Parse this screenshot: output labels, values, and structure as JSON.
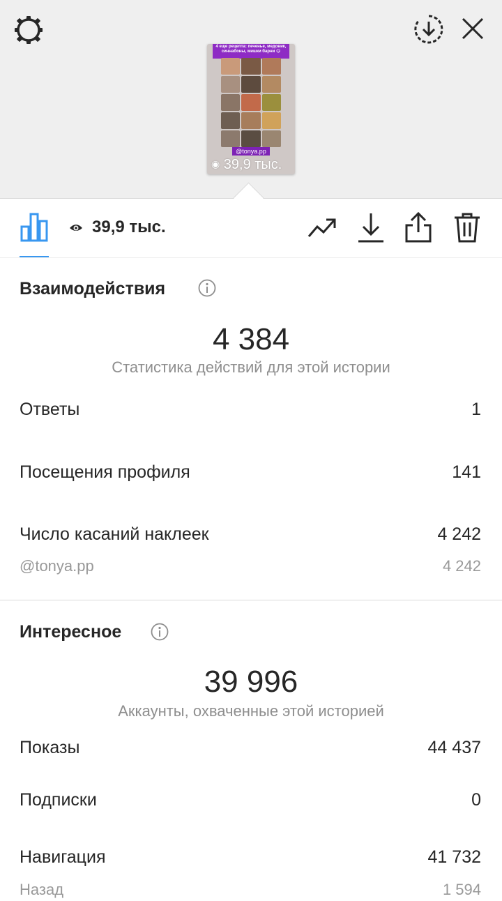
{
  "story_preview": {
    "banner_text": "4 еще рецепта: печенье, медовик, синнабоны, мишки барни 😋",
    "mention_tag": "@tonya.pp",
    "views_label": "39,9 тыс."
  },
  "toolbar": {
    "views": "39,9 тыс."
  },
  "interactions": {
    "title": "Взаимодействия",
    "total": "4 384",
    "subtitle": "Статистика действий для этой истории",
    "rows": [
      {
        "label": "Ответы",
        "value": "1"
      },
      {
        "label": "Посещения профиля",
        "value": "141"
      },
      {
        "label": "Число касаний наклеек",
        "value": "4 242"
      }
    ],
    "sticker": {
      "label": "@tonya.pp",
      "value": "4 242"
    }
  },
  "discovery": {
    "title": "Интересное",
    "total": "39 996",
    "subtitle": "Аккаунты, охваченные этой историей",
    "rows": [
      {
        "label": "Показы",
        "value": "44 437"
      },
      {
        "label": "Подписки",
        "value": "0"
      },
      {
        "label": "Навигация",
        "value": "41 732"
      },
      {
        "label": "Назад",
        "value": "1 594"
      }
    ]
  },
  "colors": {
    "accent": "#3897f0",
    "tag_purple": "#8e2bc4"
  },
  "icons": [
    "settings-icon",
    "download-circle-icon",
    "close-icon",
    "insights-bar-icon",
    "eye-icon",
    "promote-icon",
    "download-icon",
    "share-icon",
    "delete-icon",
    "info-icon"
  ]
}
